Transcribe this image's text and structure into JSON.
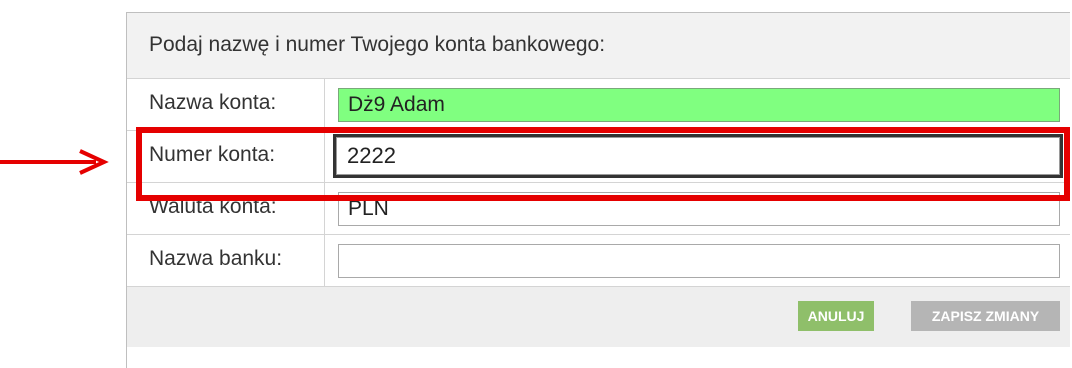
{
  "form": {
    "heading": "Podaj nazwę i numer Twojego konta bankowego:",
    "fields": [
      {
        "label": "Nazwa konta:",
        "value": "Dż9 Adam"
      },
      {
        "label": "Numer konta:",
        "value": "2222"
      },
      {
        "label": "Waluta konta:",
        "value": "PLN"
      },
      {
        "label": "Nazwa banku:",
        "value": ""
      }
    ],
    "buttons": {
      "cancel": "ANULUJ",
      "save": "ZAPISZ ZMIANY"
    }
  },
  "annotation": {
    "highlight_color": "#e50000",
    "highlighted_field": "Numer konta:",
    "arrow": "right-arrow-icon"
  },
  "colors": {
    "name_field_bg": "#80ff80",
    "cancel_bg": "#8fbf6a",
    "save_bg": "#b5b5b5"
  }
}
